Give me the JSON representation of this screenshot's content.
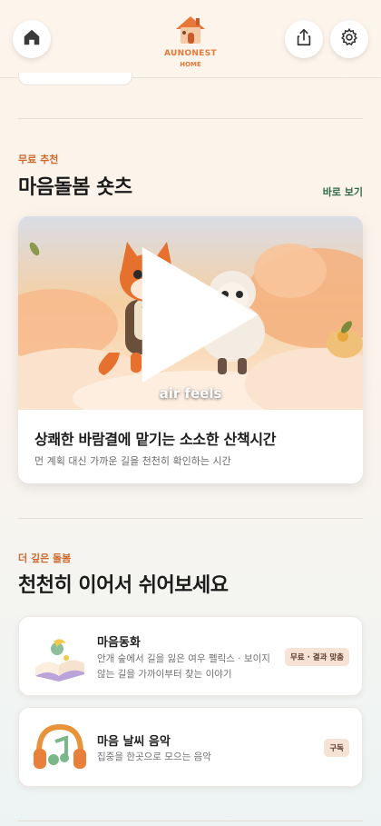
{
  "header": {
    "brand_name": "AUNONEST",
    "brand_sub": "HOME",
    "left_icon": "home-icon",
    "right_icons": [
      "share-icon",
      "gear-icon"
    ]
  },
  "shorts_section": {
    "eyebrow": "무료 추천",
    "title": "마음돌봄 숏츠",
    "see_more": "바로 보기",
    "card": {
      "caption": "air feels",
      "title": "상쾌한 바람결에 맡기는 소소한 산책시간",
      "subtitle": "먼 계획 대신 가까운 길을 천천히 확인하는 시간"
    }
  },
  "care_section": {
    "eyebrow": "더 깊은 돌봄",
    "title": "천천히 이어서 쉬어보세요",
    "items": [
      {
        "title": "마음동화",
        "desc": "안개 숲에서 길을 잃은 여우 펠릭스 · 보이지 않는 길을 가까이부터 찾는 이야기",
        "badge": "무료 · 결과 맞춤",
        "icon": "storybook-icon"
      },
      {
        "title": "마음 날씨 음악",
        "desc": "집중을 한곳으로 모으는 음악",
        "badge": "구독",
        "icon": "headphones-music-icon"
      }
    ]
  },
  "colors": {
    "accent": "#e8783a",
    "eyebrow": "#d0682c",
    "link_green": "#2f6b4a",
    "badge_bg": "#f7e2d6"
  }
}
